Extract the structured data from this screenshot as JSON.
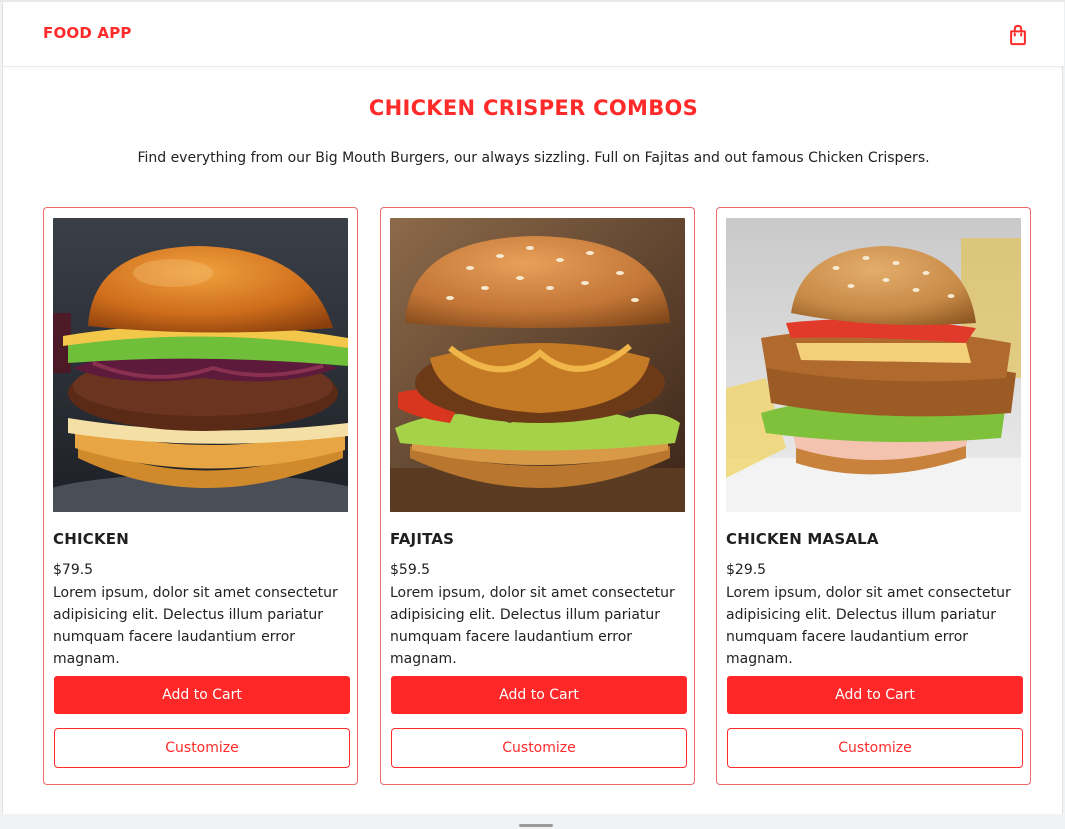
{
  "header": {
    "brand": "FOOD APP",
    "cart_icon": "shopping-bag-icon"
  },
  "section": {
    "title": "CHICKEN CRISPER COMBOS",
    "subtitle": "Find everything from our Big Mouth Burgers, our always sizzling. Full on Fajitas and out famous Chicken Crispers."
  },
  "products": [
    {
      "name": "CHICKEN",
      "price": "$79.5",
      "description": "Lorem ipsum, dolor sit amet consectetur adipisicing elit. Delectus illum pariatur numquam facere laudantium error magnam.",
      "add_label": "Add to Cart",
      "customize_label": "Customize"
    },
    {
      "name": "FAJITAS",
      "price": "$59.5",
      "description": "Lorem ipsum, dolor sit amet consectetur adipisicing elit. Delectus illum pariatur numquam facere laudantium error magnam.",
      "add_label": "Add to Cart",
      "customize_label": "Customize"
    },
    {
      "name": "CHICKEN MASALA",
      "price": "$29.5",
      "description": "Lorem ipsum, dolor sit amet consectetur adipisicing elit. Delectus illum pariatur numquam facere laudantium error magnam.",
      "add_label": "Add to Cart",
      "customize_label": "Customize"
    }
  ],
  "colors": {
    "accent": "#ff2727",
    "card_border": "#ef6a6a"
  }
}
